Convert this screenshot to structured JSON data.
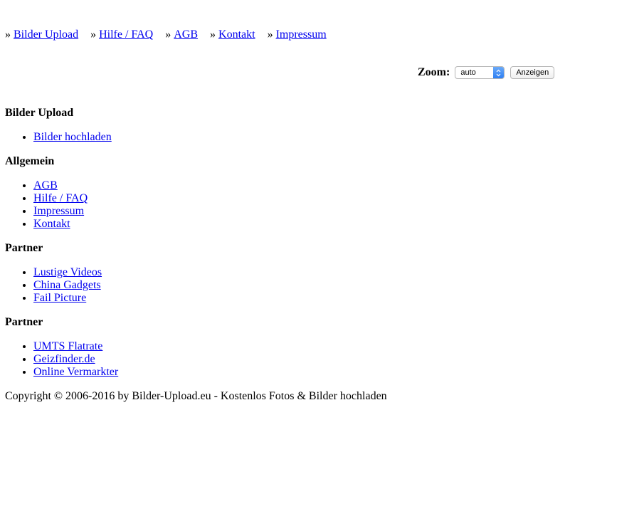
{
  "topnav": {
    "separator": "»",
    "items": [
      {
        "label": "Bilder Upload"
      },
      {
        "label": "Hilfe / FAQ"
      },
      {
        "label": "AGB"
      },
      {
        "label": "Kontakt"
      },
      {
        "label": "Impressum"
      }
    ]
  },
  "zoom": {
    "label": "Zoom:",
    "selected": "auto",
    "button_label": "Anzeigen"
  },
  "sections": [
    {
      "title": "Bilder Upload",
      "links": [
        "Bilder hochladen"
      ]
    },
    {
      "title": "Allgemein",
      "links": [
        "AGB",
        "Hilfe / FAQ",
        "Impressum",
        "Kontakt"
      ]
    },
    {
      "title": "Partner",
      "links": [
        "Lustige Videos",
        "China Gadgets",
        "Fail Picture"
      ]
    },
    {
      "title": "Partner",
      "links": [
        "UMTS Flatrate",
        "Geizfinder.de",
        "Online Vermarkter"
      ]
    }
  ],
  "footer": {
    "text": "Copyright © 2006-2016 by Bilder-Upload.eu - Kostenlos Fotos & Bilder hochladen"
  }
}
